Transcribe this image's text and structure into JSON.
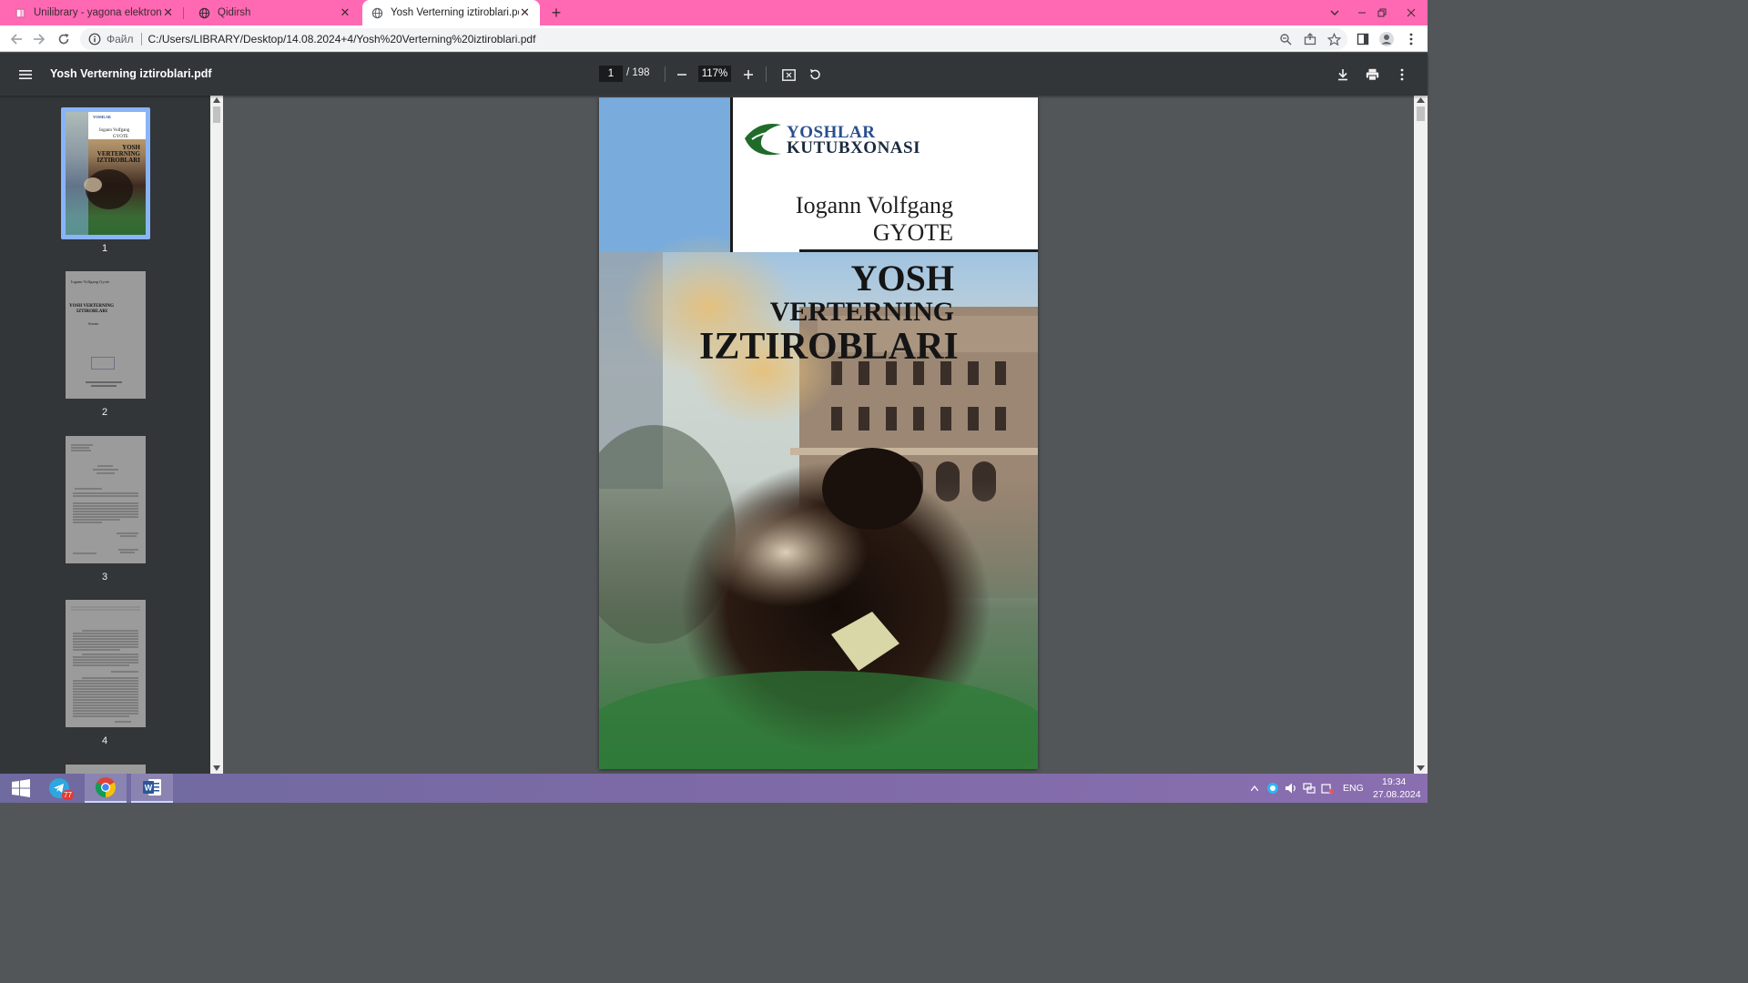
{
  "browser": {
    "tabs": [
      {
        "title": "Unilibrary - yagona elektron kutubxona",
        "active": false
      },
      {
        "title": "Qidirsh",
        "active": false
      },
      {
        "title": "Yosh Verterning iztiroblari.pdf",
        "active": true
      }
    ],
    "new_tab": "+",
    "address": {
      "scheme": "Файл",
      "url": "C:/Users/LIBRARY/Desktop/14.08.2024+4/Yosh%20Verterning%20iztiroblari.pdf"
    }
  },
  "pdf_viewer": {
    "title": "Yosh Verterning iztiroblari.pdf",
    "current_page": "1",
    "total_pages": "/ 198",
    "zoom": "117%",
    "thumbnails": [
      {
        "num": "1",
        "selected": true
      },
      {
        "num": "2",
        "selected": false
      },
      {
        "num": "3",
        "selected": false
      },
      {
        "num": "4",
        "selected": false
      }
    ],
    "thumb_texts": {
      "t1_author": "Iogann Volfgang",
      "t1_author2": "GYOTE",
      "t1_title": "YOSH VERTERNING IZTIROBLARI",
      "t2_author": "Iogann Volfgang Gyote",
      "t2_title1": "YOSH VERTERNING",
      "t2_title2": "IZTIROBLARI",
      "t2_genre": "Roman"
    }
  },
  "book_cover": {
    "publisher_line1": "YOSHLAR",
    "publisher_line2": "KUTUBXONASI",
    "author_first": "Iogann Volfgang",
    "author_last": "GYOTE",
    "title_line1": "YOSH",
    "title_line2": "VERTERNING",
    "title_line3": "IZTIROBLARI"
  },
  "taskbar": {
    "telegram_badge": "77",
    "tray": {
      "language": "ENG",
      "time": "19:34",
      "date": "27.08.2024"
    }
  },
  "colors": {
    "tabstrip": "#ff69b4",
    "pdf_toolbar": "#323639",
    "viewer_bg": "#525659",
    "cover_green": "#1f4a20",
    "publisher_blue": "#2a4f8e"
  }
}
